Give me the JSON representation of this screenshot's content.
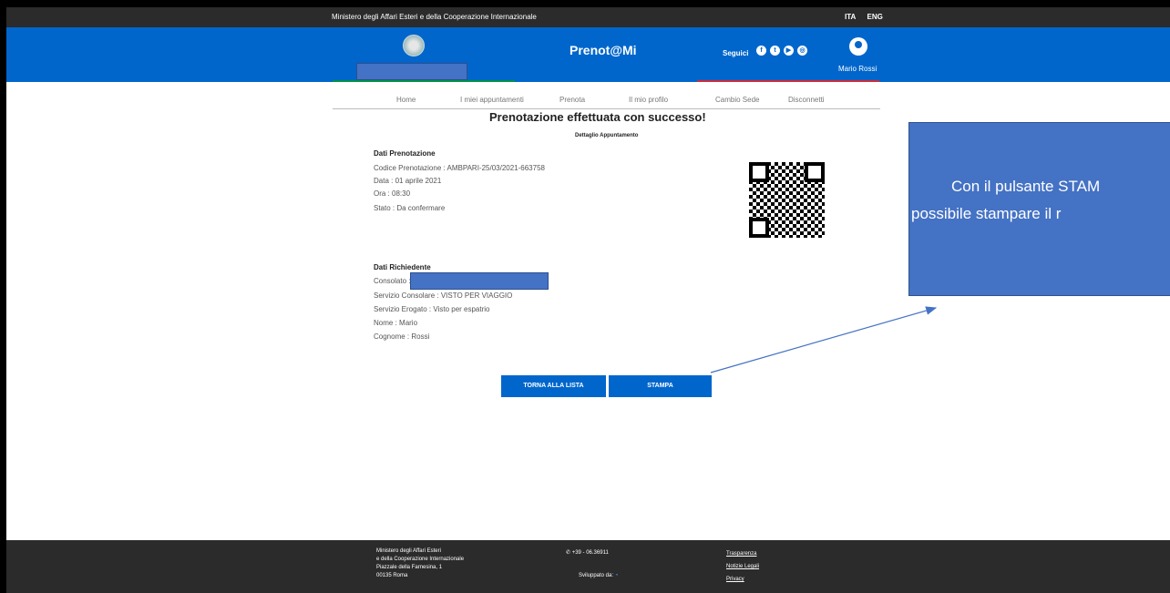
{
  "topbar": {
    "ministry": "Ministero degli Affari Esteri e della Cooperazione Internazionale",
    "languages": [
      "ITA",
      "ENG"
    ]
  },
  "header": {
    "brand": "Prenot@Mi",
    "follow_label": "Seguici",
    "social_icons": [
      "facebook-icon",
      "twitter-icon",
      "youtube-icon",
      "instagram-icon"
    ],
    "user_name": "Mario Rossi",
    "brand_color": "#0066cc"
  },
  "nav": [
    "Home",
    "I miei appuntamenti",
    "Prenota",
    "Il mio profilo",
    "Cambio Sede",
    "Disconnetti"
  ],
  "page_title": "Prenotazione effettuata con successo!",
  "detail_label": "Dettaglio Appuntamento",
  "booking": {
    "heading": "Dati Prenotazione",
    "code_label": "Codice Prenotazione :",
    "code": "AMBPARI-25/03/2021-663758",
    "date_label": "Data :",
    "date": "01 aprile 2021",
    "time_label": "Ora :",
    "time": "08:30",
    "status_label": "Stato :",
    "status": "Da confermare"
  },
  "applicant": {
    "heading": "Dati Richiedente",
    "consulate_label": "Consolato :",
    "service_label": "Servizio Consolare :",
    "service": "VISTO PER VIAGGIO",
    "delivered_label": "Servizio Erogato :",
    "delivered": "Visto per espatrio",
    "name_label": "Nome :",
    "name": "Mario",
    "surname_label": "Cognome :",
    "surname": "Rossi"
  },
  "buttons": {
    "back": "TORNA ALLA LISTA",
    "print": "STAMPA"
  },
  "callout": {
    "line1": "Con il pulsante STAM",
    "line2": "possibile stampare il r"
  },
  "footer": {
    "address": [
      "Ministero degli Affari Esteri",
      "e della Cooperazione Internazionale",
      "Piazzale della Farnesina, 1",
      "00135 Roma"
    ],
    "phone": "+39 - 06.36911",
    "developed_by": "Sviluppato da:",
    "links": [
      "Trasparenza",
      "Notizie Legali",
      "Privacy"
    ]
  }
}
